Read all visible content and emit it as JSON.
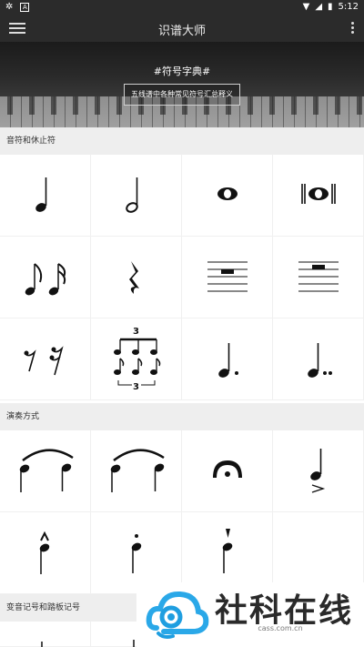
{
  "status_bar": {
    "time": "5:12",
    "left_icons": [
      "bug-icon",
      "a-icon"
    ],
    "right_icons": [
      "wifi-icon",
      "signal-icon",
      "battery-icon"
    ]
  },
  "app_bar": {
    "title": "识谱大师"
  },
  "banner": {
    "title": "#符号字典#",
    "button_label": "五线谱中各种常见符号汇总释义"
  },
  "sections": [
    {
      "title": "音符和休止符"
    },
    {
      "title": "演奏方式"
    },
    {
      "title": "变音记号和踏板记号"
    }
  ],
  "symbols": {
    "triplet_number": "3"
  },
  "watermark": {
    "text": "社科在线",
    "url": "cass.com.cn"
  }
}
